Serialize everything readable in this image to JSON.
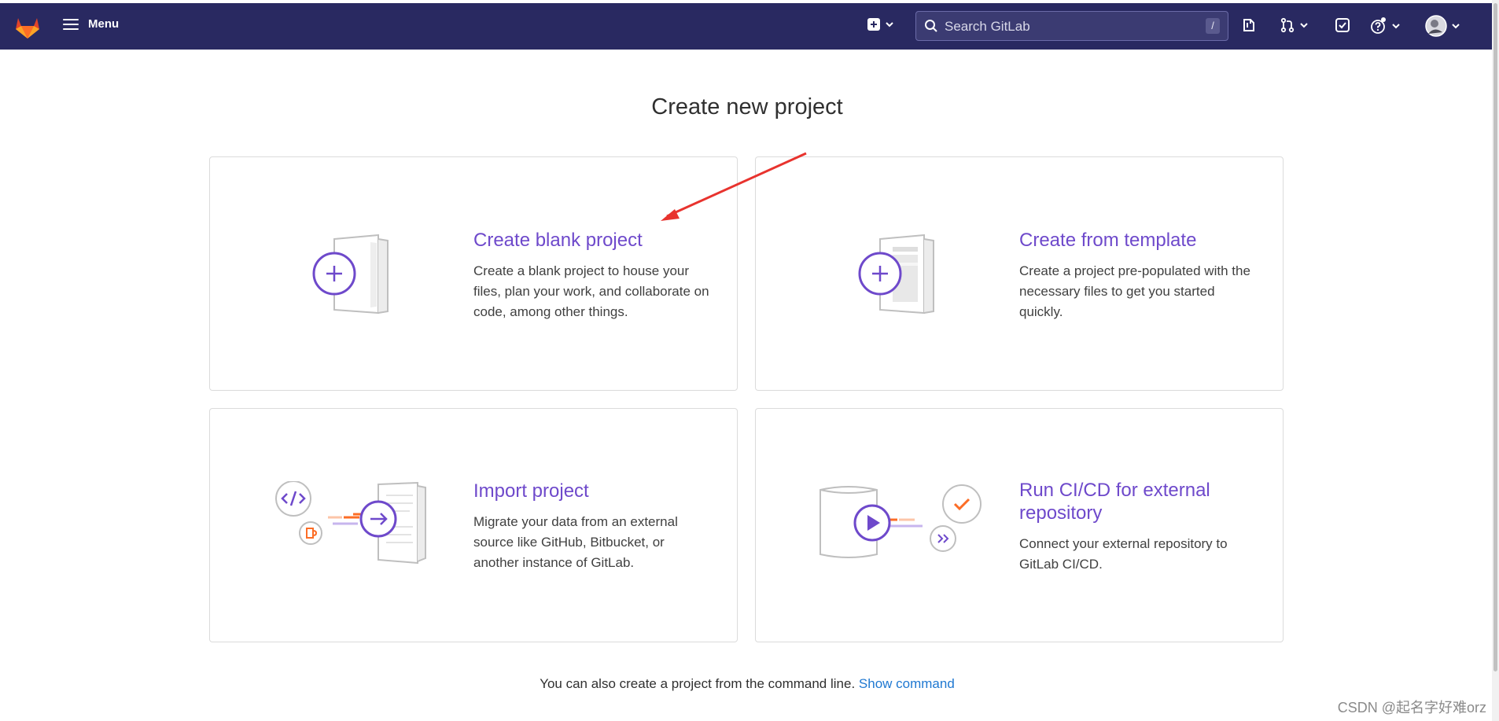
{
  "navbar": {
    "logo_icon": "gitlab-tanuki-icon",
    "menu_label": "Menu",
    "search_placeholder": "Search GitLab",
    "search_shortcut": "/",
    "icons": [
      "new-item-icon",
      "issues-icon",
      "merge-requests-icon",
      "todos-icon",
      "help-icon",
      "avatar"
    ]
  },
  "page": {
    "title": "Create new project",
    "cards": [
      {
        "title": "Create blank project",
        "description": "Create a blank project to house your files, plan your work, and collaborate on code, among other things.",
        "icon": "blank-project-illustration"
      },
      {
        "title": "Create from template",
        "description": "Create a project pre-populated with the necessary files to get you started quickly.",
        "icon": "template-project-illustration"
      },
      {
        "title": "Import project",
        "description": "Migrate your data from an external source like GitHub, Bitbucket, or another instance of GitLab.",
        "icon": "import-project-illustration"
      },
      {
        "title": "Run CI/CD for external repository",
        "description": "Connect your external repository to GitLab CI/CD.",
        "icon": "cicd-project-illustration"
      }
    ],
    "footer_text": "You can also create a project from the command line.",
    "footer_link": "Show command"
  },
  "watermark": "CSDN @起名字好难orz",
  "colors": {
    "navbar_bg": "#292961",
    "accent_purple": "#6e49cb",
    "link_blue": "#1f78d1",
    "annotation_red": "#e8332e",
    "orange": "#fc6d26"
  }
}
